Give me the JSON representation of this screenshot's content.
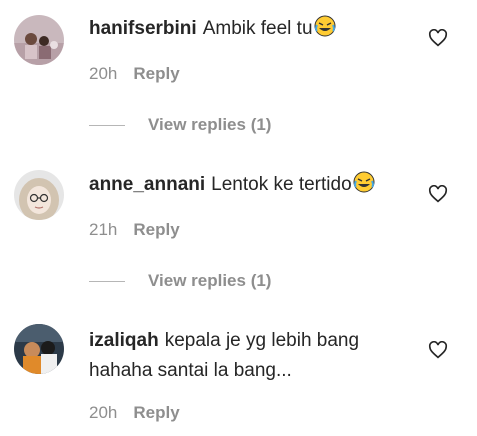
{
  "comments": [
    {
      "username": "hanifserbini",
      "text": "Ambik feel tu",
      "emoji": "tears-of-joy",
      "time": "20h",
      "reply_label": "Reply",
      "view_replies": "View replies (1)"
    },
    {
      "username": "anne_annani",
      "text": "Lentok ke tertido",
      "emoji": "tears-of-joy",
      "time": "21h",
      "reply_label": "Reply",
      "view_replies": "View replies (1)"
    },
    {
      "username": "izaliqah",
      "text_line1": "kepala je yg lebih bang",
      "text_line2": "hahaha santai la bang...",
      "time": "20h",
      "reply_label": "Reply"
    }
  ],
  "icons": {
    "like": "heart-outline-icon",
    "emoji": "face-with-tears-of-joy-icon"
  },
  "colors": {
    "primary_text": "#262626",
    "secondary_text": "#8e8e8e"
  }
}
